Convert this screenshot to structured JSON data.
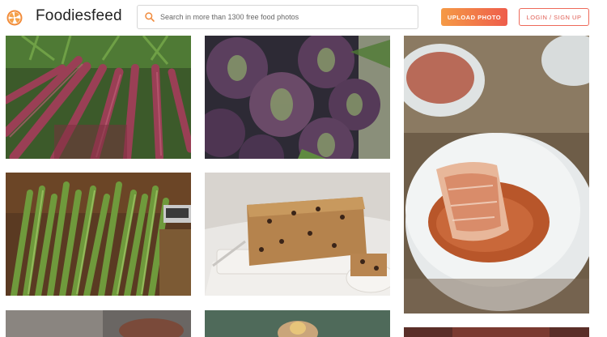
{
  "header": {
    "logo_text": "Foodiesfeed",
    "logo_icon": "orange-citrus-slice-icon",
    "search_placeholder": "Search in more than 1300 free food photos",
    "upload_label": "UPLOAD PHOTO",
    "login_label": "LOGIN / SIGN UP"
  },
  "colors": {
    "accent_gradient_start": "#f59a46",
    "accent_gradient_end": "#ee5d4b",
    "login_border": "#ee6a5a"
  },
  "gallery": {
    "photos": [
      {
        "subject": "purple carrots bundle"
      },
      {
        "subject": "purple artichokes"
      },
      {
        "subject": "kimchi in white bowl"
      },
      {
        "subject": "green asparagus bundles"
      },
      {
        "subject": "fruit loaf cake on plate"
      },
      {
        "subject": "food photo (partially visible)"
      },
      {
        "subject": "food photo (partially visible)"
      },
      {
        "subject": "food photo (partially visible)"
      }
    ]
  }
}
